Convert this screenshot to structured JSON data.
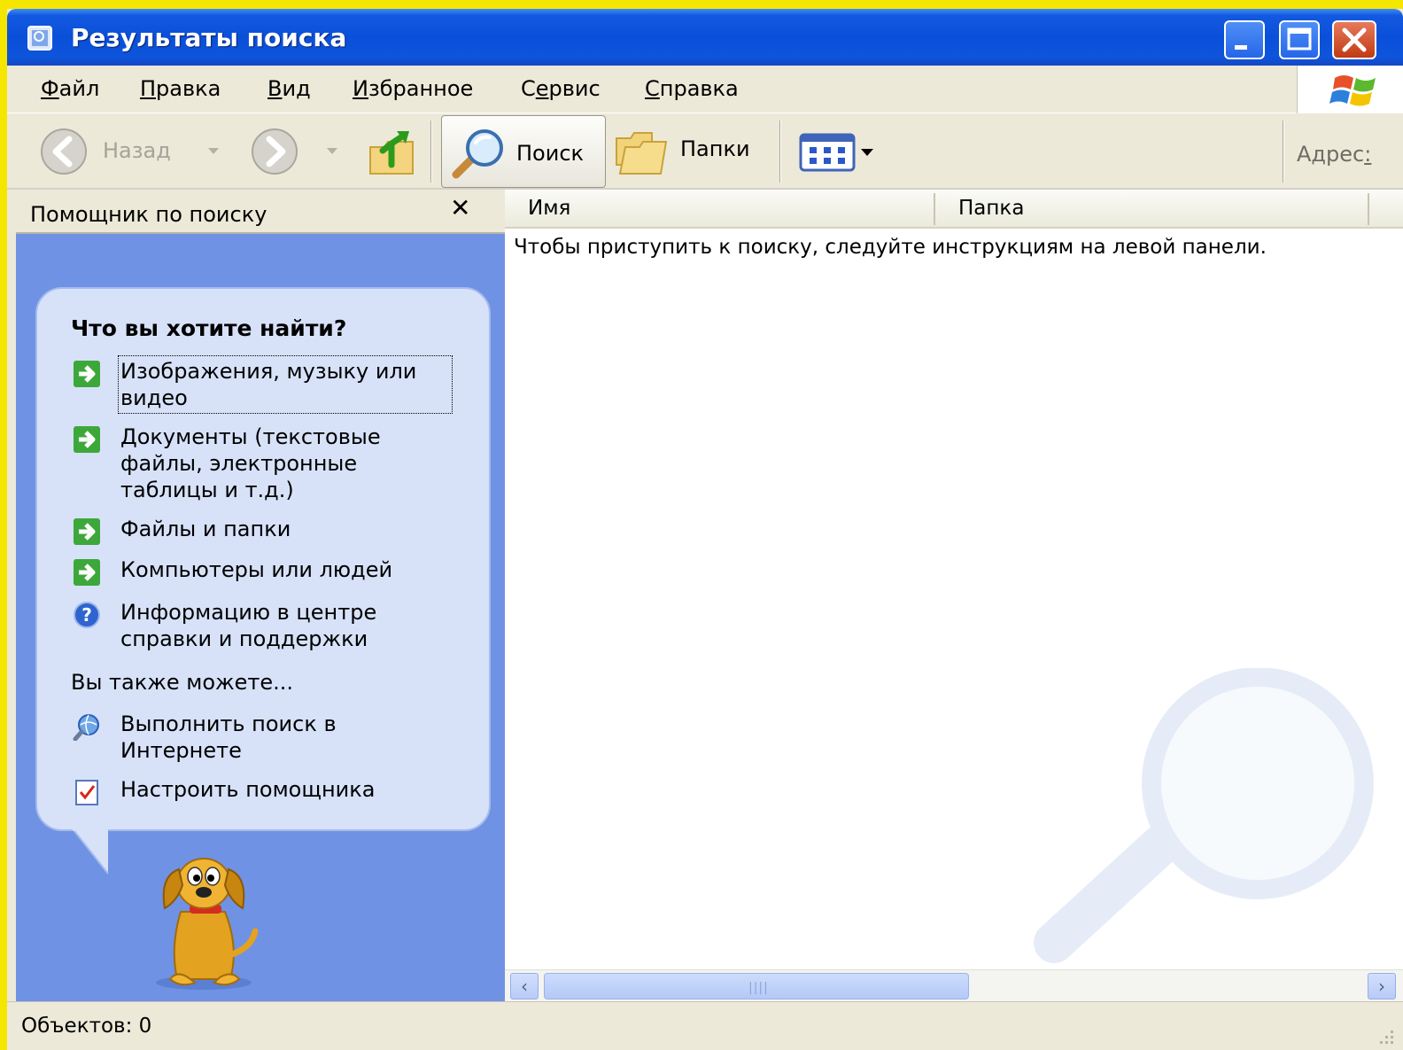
{
  "window": {
    "title": "Результаты поиска"
  },
  "menu": [
    {
      "label": "Файл",
      "accel": "Ф",
      "rest": "айл"
    },
    {
      "label": "Правка",
      "accel": "П",
      "rest": "равка"
    },
    {
      "label": "Вид",
      "accel": "В",
      "rest": "ид"
    },
    {
      "label": "Избранное",
      "accel": "И",
      "rest": "збранное"
    },
    {
      "label": "Сервис",
      "pre": "С",
      "accel": "е",
      "rest": "рвис"
    },
    {
      "label": "Справка",
      "accel": "С",
      "rest": "правка"
    }
  ],
  "toolbar": {
    "back_label": "Назад",
    "search_label": "Поиск",
    "folders_label": "Папки",
    "address_label": "Адрес"
  },
  "left_pane": {
    "header": "Помощник по поиску",
    "question": "Что вы хотите найти?",
    "options": [
      {
        "text": "Изображения, музыку или видео",
        "icon": "green-arrow-icon"
      },
      {
        "text": "Документы (текстовые файлы, электронные таблицы и т.д.)",
        "icon": "green-arrow-icon"
      },
      {
        "text": "Файлы и папки",
        "icon": "green-arrow-icon"
      },
      {
        "text": "Компьютеры или людей",
        "icon": "green-arrow-icon"
      },
      {
        "text": "Информацию в центре справки и поддержки",
        "icon": "help-icon"
      }
    ],
    "also_label": "Вы также можете...",
    "also_options": [
      {
        "text": "Выполнить поиск в Интернете",
        "icon": "internet-search-icon"
      },
      {
        "text": "Настроить помощника",
        "icon": "settings-checkbox-icon"
      }
    ]
  },
  "results": {
    "columns": [
      "Имя",
      "Папка"
    ],
    "hint": "Чтобы приступить к поиску, следуйте инструкциям на левой панели."
  },
  "status": {
    "text": "Объектов: 0"
  },
  "colors": {
    "title_blue": "#0a4fd9",
    "pane_blue": "#6f92e4",
    "bubble": "#d7e2f9",
    "desktop": "#f5e600"
  }
}
